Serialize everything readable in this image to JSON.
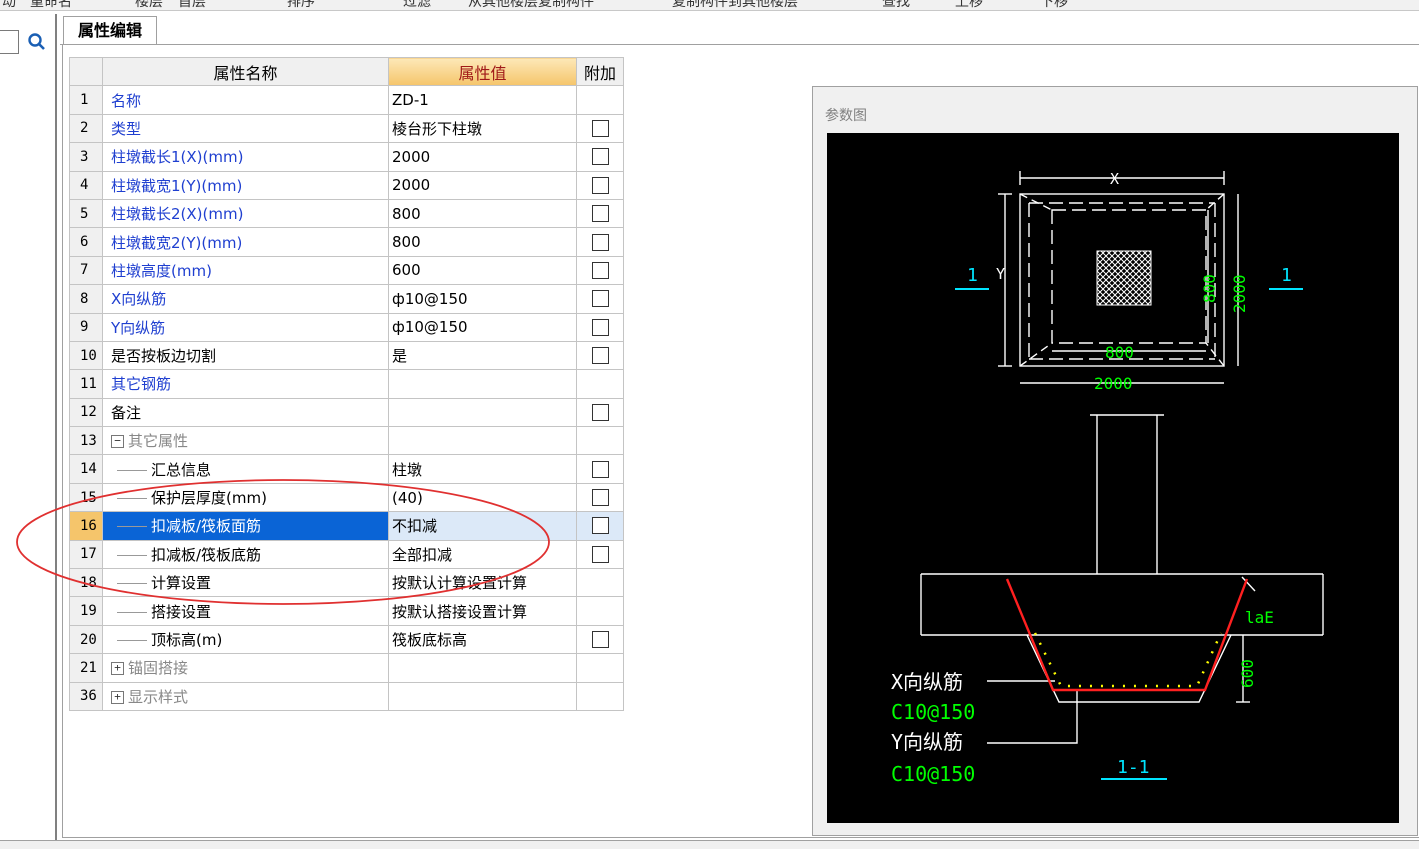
{
  "toolbar": {
    "items": [
      "动",
      "重命名",
      "楼层",
      "首层",
      "排序",
      "过滤",
      "从其他楼层复制构件",
      "复制构件到其他楼层",
      "查找",
      "上移",
      "下移"
    ]
  },
  "tab": {
    "label": "属性编辑"
  },
  "grid": {
    "headers": {
      "name": "属性名称",
      "value": "属性值",
      "extra": "附加"
    },
    "rows": [
      {
        "num": "1",
        "name": "名称",
        "value": "ZD-1",
        "style": "blue",
        "level": 0,
        "cb": false
      },
      {
        "num": "2",
        "name": "类型",
        "value": "棱台形下柱墩",
        "style": "blue",
        "level": 0,
        "cb": true
      },
      {
        "num": "3",
        "name": "柱墩截长1(X)(mm)",
        "value": "2000",
        "style": "blue",
        "level": 0,
        "cb": true
      },
      {
        "num": "4",
        "name": "柱墩截宽1(Y)(mm)",
        "value": "2000",
        "style": "blue",
        "level": 0,
        "cb": true
      },
      {
        "num": "5",
        "name": "柱墩截长2(X)(mm)",
        "value": "800",
        "style": "blue",
        "level": 0,
        "cb": true
      },
      {
        "num": "6",
        "name": "柱墩截宽2(Y)(mm)",
        "value": "800",
        "style": "blue",
        "level": 0,
        "cb": true
      },
      {
        "num": "7",
        "name": "柱墩高度(mm)",
        "value": "600",
        "style": "blue",
        "level": 0,
        "cb": true
      },
      {
        "num": "8",
        "name": "X向纵筋",
        "value": " ф10@150",
        "style": "blue",
        "level": 0,
        "cb": true
      },
      {
        "num": "9",
        "name": "Y向纵筋",
        "value": " ф10@150",
        "style": "blue",
        "level": 0,
        "cb": true
      },
      {
        "num": "10",
        "name": "是否按板边切割",
        "value": "是",
        "style": "black",
        "level": 0,
        "cb": true
      },
      {
        "num": "11",
        "name": "其它钢筋",
        "value": "",
        "style": "blue",
        "level": 0,
        "cb": false
      },
      {
        "num": "12",
        "name": "备注",
        "value": "",
        "style": "black",
        "level": 0,
        "cb": true
      },
      {
        "num": "13",
        "name": "其它属性",
        "value": "",
        "style": "gray",
        "level": 0,
        "cb": false,
        "toggle": "−"
      },
      {
        "num": "14",
        "name": "汇总信息",
        "value": "柱墩",
        "style": "black",
        "level": 1,
        "cb": true
      },
      {
        "num": "15",
        "name": "保护层厚度(mm)",
        "value": "(40)",
        "style": "black",
        "level": 1,
        "cb": true
      },
      {
        "num": "16",
        "name": "扣减板/筏板面筋",
        "value": "不扣减",
        "style": "black",
        "level": 1,
        "cb": true,
        "selected": true
      },
      {
        "num": "17",
        "name": "扣减板/筏板底筋",
        "value": "全部扣减",
        "style": "black",
        "level": 1,
        "cb": true
      },
      {
        "num": "18",
        "name": "计算设置",
        "value": "按默认计算设置计算",
        "style": "black",
        "level": 1,
        "cb": false
      },
      {
        "num": "19",
        "name": "搭接设置",
        "value": "按默认搭接设置计算",
        "style": "black",
        "level": 1,
        "cb": false
      },
      {
        "num": "20",
        "name": "顶标高(m)",
        "value": "筏板底标高",
        "style": "black",
        "level": 1,
        "cb": true
      },
      {
        "num": "21",
        "name": "锚固搭接",
        "value": "",
        "style": "gray",
        "level": 0,
        "cb": false,
        "toggle": "+"
      },
      {
        "num": "36",
        "name": "显示样式",
        "value": "",
        "style": "gray",
        "level": 0,
        "cb": false,
        "toggle": "+"
      }
    ]
  },
  "param_panel": {
    "title": "参数图",
    "labels": {
      "x": "X",
      "y": "Y",
      "dim_800_v": "800",
      "dim_2000_v": "2000",
      "dim_800_h": "800",
      "dim_2000_h": "2000",
      "sec_left": "1",
      "sec_right": "1",
      "lae": "laE",
      "h600": "600",
      "x_bar": "X向纵筋",
      "x_bar_val": "C10@150",
      "y_bar": "Y向纵筋",
      "y_bar_val": "C10@150",
      "section": "1-1"
    },
    "colors": {
      "line": "#ffffff",
      "dim": "#00ff00",
      "accent": "#00e5ff",
      "rebar": "#ff2020",
      "dots": "#ffff00"
    }
  },
  "annotation": {
    "ellipse_color": "#e03030"
  }
}
